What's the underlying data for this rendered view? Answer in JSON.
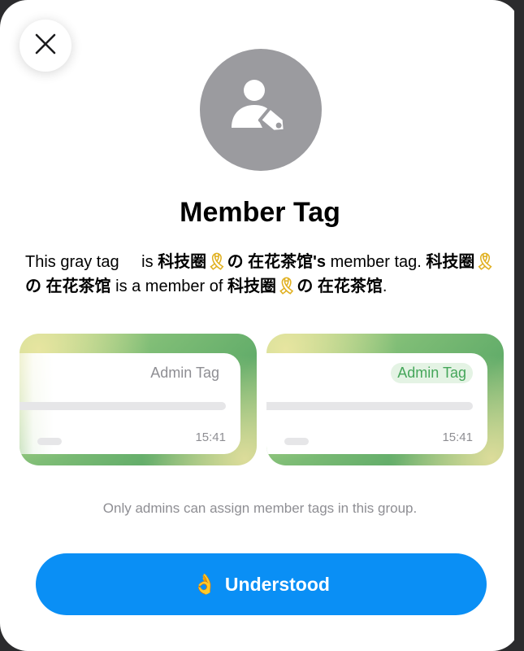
{
  "modal": {
    "close_icon": "close-icon",
    "hero_icon": "person-tag-icon",
    "title": "Member Tag",
    "desc": {
      "p1": "This gray tag",
      "p2": "is",
      "group_prefix": "科技圈",
      "ribbon": "🎗",
      "group_suffix": "の 在花茶馆",
      "possessive": "'s",
      "p3": "member tag.",
      "p4": "is a member of",
      "end": "."
    },
    "examples": [
      {
        "tag": "Admin Tag",
        "time": "15:41",
        "style": "gray"
      },
      {
        "tag": "Admin Tag",
        "time": "15:41",
        "style": "green"
      }
    ],
    "note": "Only admins can assign member tags in this group.",
    "button": {
      "icon": "ok-hand-icon",
      "glyph": "👌",
      "label": "Understood"
    }
  },
  "colors": {
    "accent": "#0a8ff5",
    "hero_bg": "#9b9b9f",
    "tag_green": "#45a65a",
    "ribbon": "#e0b020"
  }
}
